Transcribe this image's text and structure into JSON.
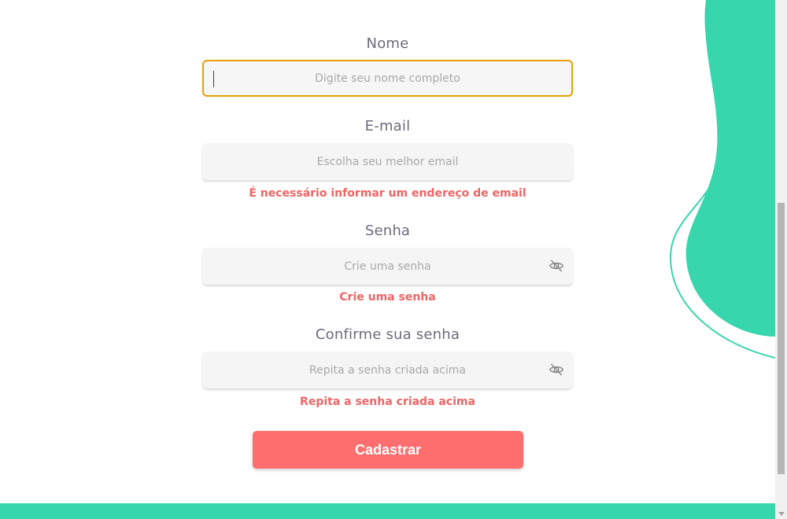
{
  "colors": {
    "accent_teal": "#37d6ad",
    "error_red": "#f06464",
    "button_coral": "#fe6e6e",
    "focus_orange": "#e5a000",
    "label_gray": "#6b6b7b"
  },
  "form": {
    "name": {
      "label": "Nome",
      "placeholder": "Digite seu nome completo",
      "value": ""
    },
    "email": {
      "label": "E-mail",
      "placeholder": "Escolha seu melhor email",
      "value": "",
      "error": "É necessário informar um endereço de email"
    },
    "password": {
      "label": "Senha",
      "placeholder": "Crie uma senha",
      "value": "",
      "error": "Crie uma senha",
      "toggle_icon": "eye-slash-icon"
    },
    "confirm_password": {
      "label": "Confirme sua senha",
      "placeholder": "Repita a senha criada acima",
      "value": "",
      "error": "Repita a senha criada acima",
      "toggle_icon": "eye-slash-icon"
    },
    "submit_label": "Cadastrar"
  }
}
